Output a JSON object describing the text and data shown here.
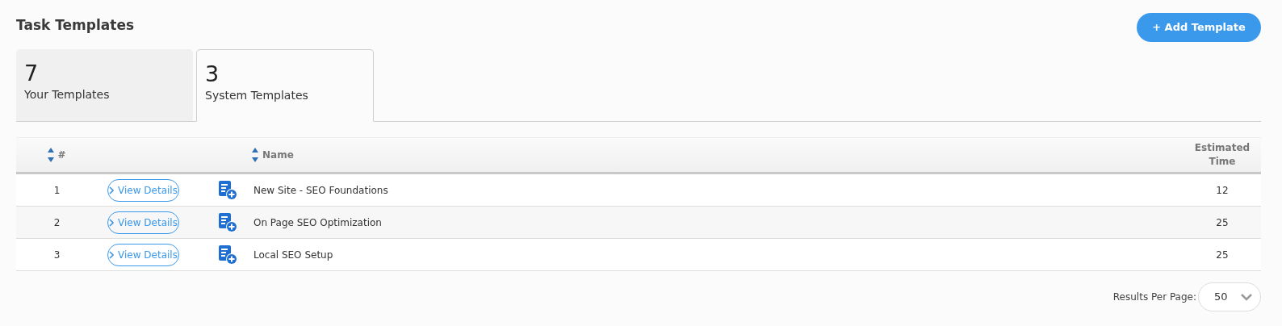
{
  "title": "Task Templates",
  "add_button": "+ Add Template",
  "tabs": [
    {
      "count": "7",
      "label": "Your Templates",
      "selected": false
    },
    {
      "count": "3",
      "label": "System Templates",
      "selected": true
    }
  ],
  "table": {
    "columns": [
      "#",
      "Name",
      "Estimated Time"
    ],
    "rows": [
      {
        "number": "1",
        "action": "View Details",
        "name": "New Site - SEO Foundations",
        "estimated_time": "12"
      },
      {
        "number": "2",
        "action": "View Details",
        "name": "On Page SEO Optimization",
        "estimated_time": "25"
      },
      {
        "number": "3",
        "action": "View Details",
        "name": "Local SEO Setup",
        "estimated_time": "25"
      }
    ]
  },
  "pagination": {
    "label": "Results Per Page:",
    "value": "50"
  }
}
